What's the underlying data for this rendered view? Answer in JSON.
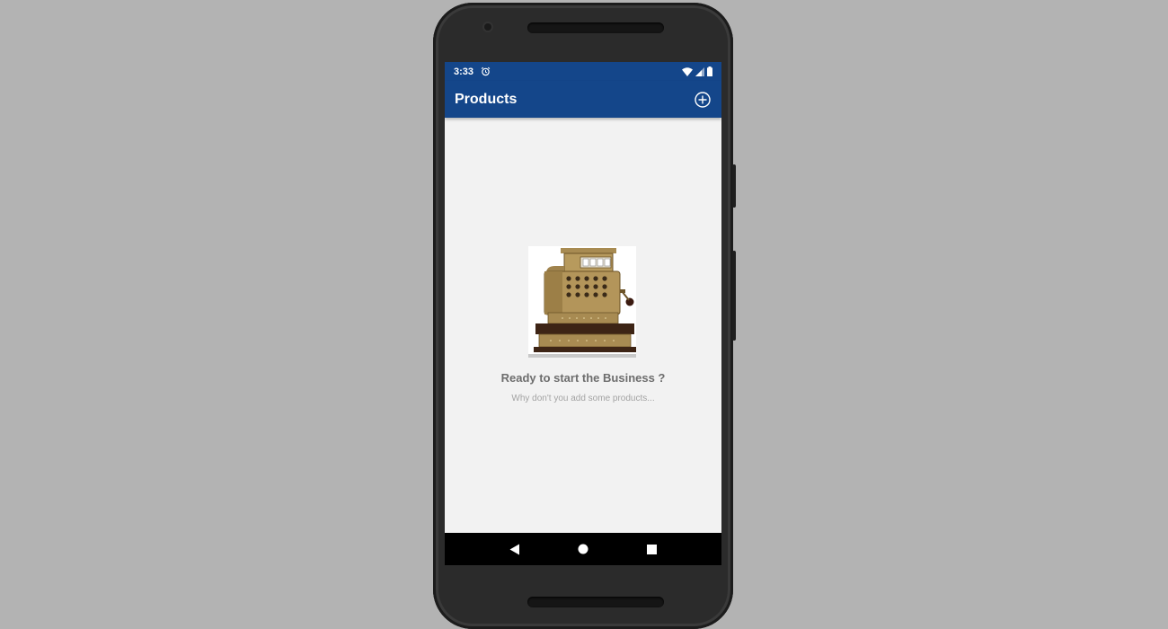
{
  "status_bar": {
    "time": "3:33"
  },
  "app_bar": {
    "title": "Products"
  },
  "empty_state": {
    "title": "Ready to start the Business ?",
    "subtitle": "Why don't you add some products..."
  },
  "colors": {
    "primary": "#14468a",
    "background": "#f2f2f2"
  },
  "icons": {
    "status": [
      "alarm-icon",
      "wifi-icon",
      "signal-icon",
      "battery-icon"
    ],
    "app_bar": "add-circle-icon",
    "nav": [
      "back-icon",
      "home-icon",
      "recents-icon"
    ]
  }
}
